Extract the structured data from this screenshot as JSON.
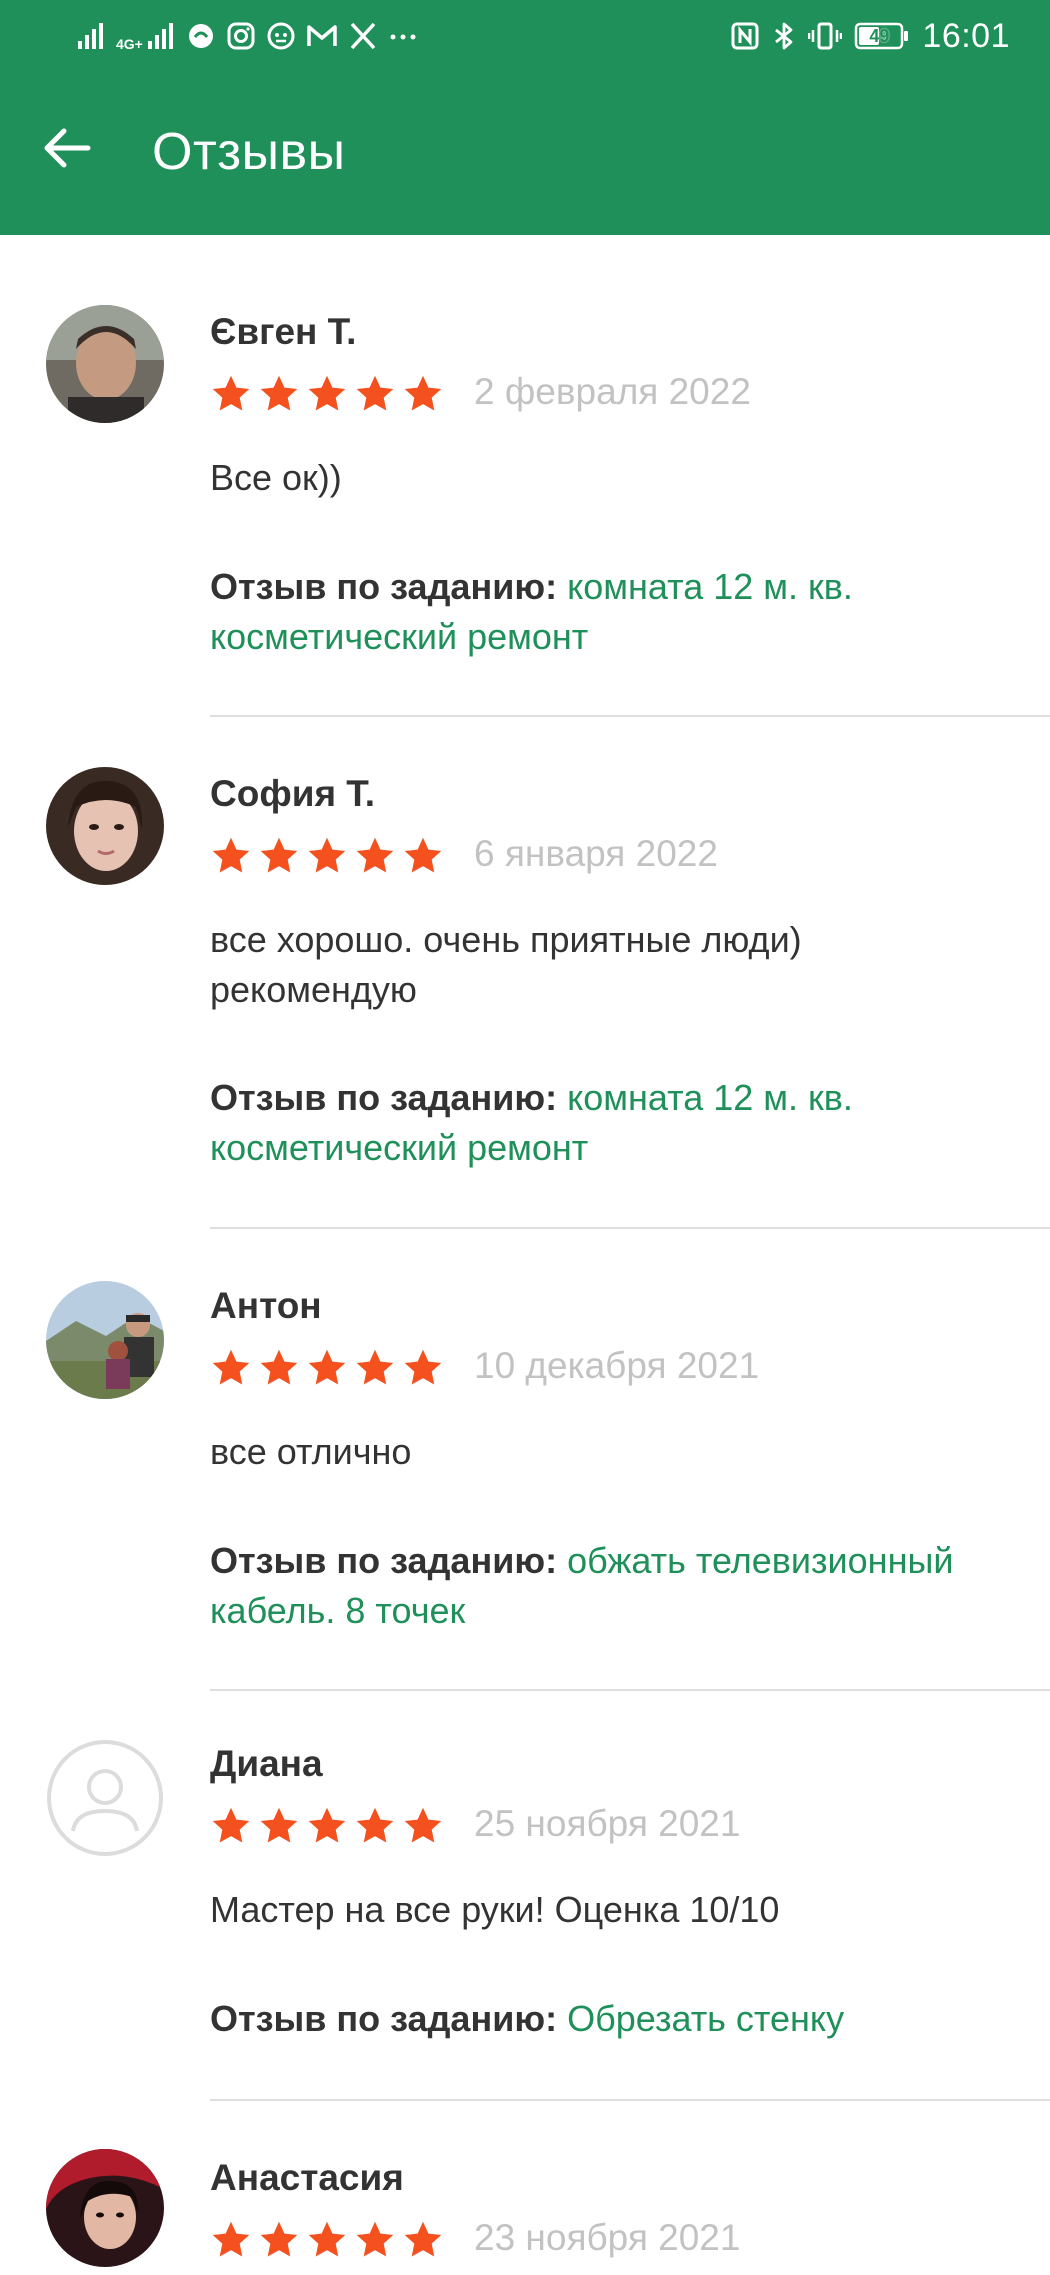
{
  "status_bar": {
    "network_label": "4G+",
    "battery_level": "49",
    "time": "16:01",
    "left_icons": [
      "signal-icon",
      "signal-4g-icon",
      "chat-app-icon",
      "instagram-icon",
      "pig-app-icon",
      "gmail-icon",
      "x-icon",
      "more-dots-icon"
    ],
    "right_icons": [
      "nfc-icon",
      "bluetooth-icon",
      "vibrate-icon",
      "battery-icon"
    ]
  },
  "header": {
    "title": "Отзывы",
    "back_icon": "arrow-left-icon",
    "background_color": "#1f9059"
  },
  "colors": {
    "accent": "#1f9059",
    "star": "#f4511e",
    "date": "#c2c2c2",
    "divider": "#dedede"
  },
  "task_prefix": "Отзыв по заданию:",
  "reviews": [
    {
      "name": "Євген Т.",
      "rating": 5,
      "date": "2 февраля 2022",
      "text": "Все ок))",
      "task": "комната 12 м. кв. косметический ремонт",
      "avatar": "photo"
    },
    {
      "name": "София Т.",
      "rating": 5,
      "date": "6 января 2022",
      "text": "все хорошо. очень  приятные люди)\nрекомендую",
      "task": "комната 12 м. кв. косметический ремонт",
      "avatar": "photo"
    },
    {
      "name": "Антон",
      "rating": 5,
      "date": "10 декабря 2021",
      "text": "все отлично",
      "task": "обжать телевизионный кабель. 8 точек",
      "avatar": "photo"
    },
    {
      "name": "Диана",
      "rating": 5,
      "date": "25 ноября 2021",
      "text": "Мастер на все руки! Оценка 10/10",
      "task": "Обрезать стенку",
      "avatar": "placeholder-user-icon"
    },
    {
      "name": "Анастасия",
      "rating": 5,
      "date": "23 ноября 2021",
      "avatar": "photo"
    }
  ]
}
